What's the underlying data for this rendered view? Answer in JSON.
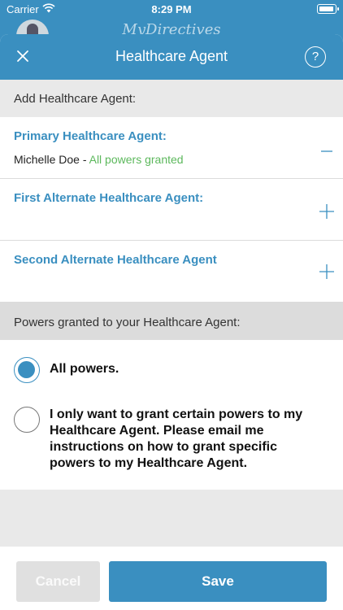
{
  "status_bar": {
    "carrier": "Carrier",
    "time": "8:29 PM"
  },
  "background_app": {
    "brand": "MyDirectives"
  },
  "navbar": {
    "title": "Healthcare Agent",
    "help": "?"
  },
  "add_section": {
    "header": "Add Healthcare Agent:"
  },
  "agents": [
    {
      "label": "Primary Healthcare Agent:",
      "name": "Michelle Doe",
      "separator": " - ",
      "status": "All powers granted",
      "action": "minus"
    },
    {
      "label": "First Alternate Healthcare Agent:",
      "action": "plus"
    },
    {
      "label": "Second Alternate Healthcare Agent",
      "action": "plus"
    }
  ],
  "powers": {
    "header": "Powers granted to your Healthcare Agent:",
    "options": [
      {
        "label": "All powers.",
        "selected": true
      },
      {
        "label": "I only want to grant certain powers to my Healthcare Agent. Please email me instructions on how to grant specific powers to my Healthcare Agent.",
        "selected": false
      }
    ]
  },
  "footer": {
    "cancel_label": "Cancel",
    "save_label": "Save"
  },
  "colors": {
    "accent": "#3a8fc0",
    "granted": "#5cb85c",
    "disabled": "#e0e0e0"
  }
}
